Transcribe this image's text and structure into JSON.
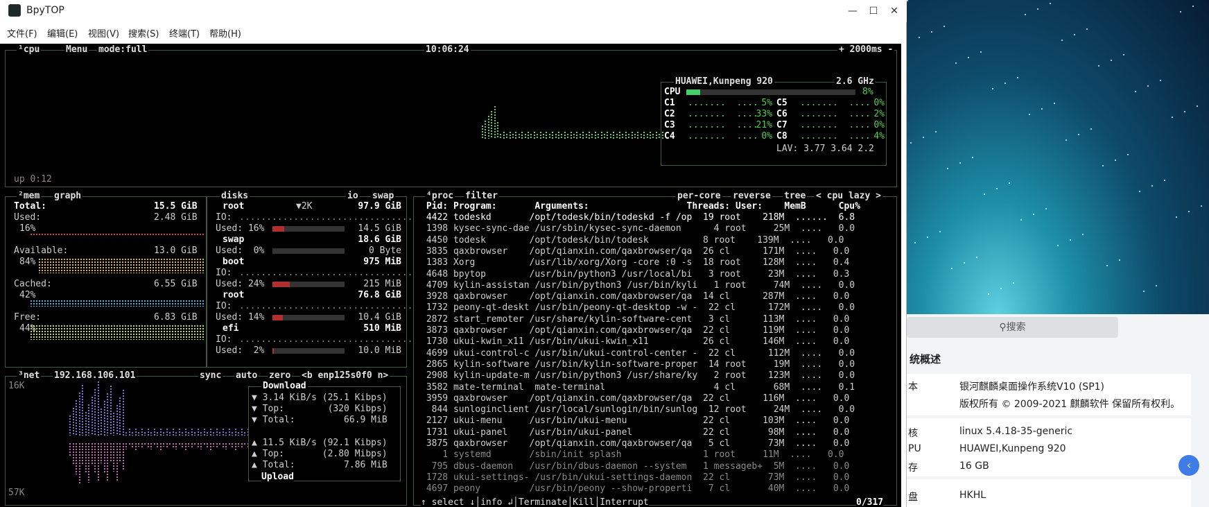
{
  "window": {
    "title": "BpyTOP",
    "minimize": "—",
    "maximize": "☐",
    "close": "✕"
  },
  "menu": [
    "文件(F)",
    "编辑(E)",
    "视图(V)",
    "搜索(S)",
    "终端(T)",
    "帮助(H)"
  ],
  "cpu": {
    "tab": "¹cpu",
    "menu": "Menu",
    "mode": "mode:full",
    "clock": "10:06:24",
    "interval": "2000ms",
    "uptime": "up 0:12",
    "model": "HUAWEI,Kunpeng 920",
    "freq": "2.6 GHz",
    "total_label": "CPU",
    "total_pct": "8%",
    "total_frac": 0.08,
    "cores": [
      {
        "n": "C1",
        "p": "5%"
      },
      {
        "n": "C5",
        "p": "0%"
      },
      {
        "n": "C2",
        "p": "33%"
      },
      {
        "n": "C6",
        "p": "2%"
      },
      {
        "n": "C3",
        "p": "21%"
      },
      {
        "n": "C7",
        "p": "0%"
      },
      {
        "n": "C4",
        "p": "0%"
      },
      {
        "n": "C8",
        "p": "4%"
      }
    ],
    "lav": "LAV: 3.77 3.64 2.2"
  },
  "mem": {
    "tab": "²mem",
    "graph": "graph",
    "total_label": "Total:",
    "total": "15.5 GiB",
    "used_label": "Used:",
    "used": "2.48 GiB",
    "used_pct": "16%",
    "avail_label": "Available:",
    "avail": "13.0 GiB",
    "avail_pct": "84%",
    "cached_label": "Cached:",
    "cached": "6.55 GiB",
    "cached_pct": "42%",
    "free_label": "Free:",
    "free": "6.83 GiB",
    "free_pct": "44%"
  },
  "disks": {
    "tab": "disks",
    "io": "io",
    "swap": "swap",
    "items": [
      {
        "name": "root",
        "extra": "▼2K",
        "size": "97.9 GiB",
        "io": "IO:",
        "used": "Used: 16%",
        "val": "14.5 GiB",
        "frac": 0.16
      },
      {
        "name": "swap",
        "extra": "",
        "size": "18.6 GiB",
        "io": "",
        "used": "Used:  0%",
        "val": "0 Byte",
        "frac": 0
      },
      {
        "name": "boot",
        "extra": "",
        "size": "975 MiB",
        "io": "IO:",
        "used": "Used: 24%",
        "val": "215 MiB",
        "frac": 0.24
      },
      {
        "name": "root",
        "extra": "",
        "size": "76.8 GiB",
        "io": "IO:",
        "used": "Used: 14%",
        "val": "10.4 GiB",
        "frac": 0.14
      },
      {
        "name": "efi",
        "extra": "",
        "size": "510 MiB",
        "io": "IO:",
        "used": "Used:  2%",
        "val": "10.0 MiB",
        "frac": 0.02
      }
    ]
  },
  "net": {
    "tab": "³net",
    "ip": "192.168.106.101",
    "sync": "sync",
    "auto": "auto",
    "zero": "zero",
    "iface": "<b enp125s0f0 n>",
    "scale_top": "16K",
    "scale_bot": "57K",
    "download": "Download",
    "dl_rate": "▼ 3.14 KiB/s (25.1 Kibps)",
    "dl_top": "▼ Top:        (320 Kibps)",
    "dl_total": "▼ Total:         66.9 MiB",
    "ul_rate": "▲ 11.5 KiB/s (92.1 Kibps)",
    "ul_top": "▲ Top:       (2.80 Mibps)",
    "ul_total": "▲ Total:         7.86 MiB",
    "upload": "Upload"
  },
  "proc": {
    "tab": "⁴proc",
    "filter": "filter",
    "per_core": "per-core",
    "reverse": "reverse",
    "tree": "tree",
    "sort": "< cpu lazy >",
    "header": " Pid: Program:       Arguments:                  Threads: User:    MemB      Cpu%",
    "rows": [
      " 4422 todeskd       /opt/todesk/bin/todeskd -f /op  19 root    218M  ......  6.8",
      " 1398 kysec-sync-dae /usr/sbin/kysec-sync-daemon      4 root     25M  ....   0.0",
      " 4450 todesk        /opt/todesk/bin/todesk          8 root    139M  ....   0.0",
      " 3835 qaxbrowser    /opt/qianxin.com/qaxbrowser/qa  26 cl      171M  ....   0.0",
      " 1383 Xorg          /usr/lib/xorg/Xorg -core :0 -s  18 root    128M  ....   0.4",
      " 4648 bpytop        /usr/bin/python3 /usr/local/bi   3 root     23M  ....   0.3",
      " 4709 kylin-assistan /usr/bin/python3 /usr/bin/kyli   1 root     74M  ....   0.0",
      " 3928 qaxbrowser    /opt/qianxin.com/qaxbrowser/qa  14 cl      287M  ....   0.0",
      " 1732 peony-qt-deskt /usr/bin/peony-qt-desktop -w -  22 cl      172M  ....   0.0",
      " 2872 start_remoter /usr/share/kylin-software-cent   3 cl      113M  ....   0.0",
      " 3873 qaxbrowser    /opt/qianxin.com/qaxbrowser/qa  22 cl      119M  ....   0.0",
      " 1730 ukui-kwin_x11 /usr/bin/ukui-kwin_x11          26 cl      146M  ....   0.0",
      " 4699 ukui-control-c /usr/bin/ukui-control-center -  22 cl      112M  ....   0.0",
      " 2865 kylin-software /usr/bin/kylin-software-proper  14 root     19M  ....   0.0",
      " 2908 kylin-update-m /usr/bin/python3 /usr/share/ky   2 root    123M  ....   0.0",
      " 3582 mate-terminal  mate-terminal                    4 cl       68M  ....   0.1",
      " 3959 qaxbrowser    /opt/qianxin.com/qaxbrowser/qa  22 cl      116M  ....   0.0",
      "  844 sunloginclient /usr/local/sunlogin/bin/sunlog  12 root     24M  ....   0.0",
      " 2127 ukui-menu     /usr/bin/ukui-menu              22 cl      103M  ....   0.0",
      " 1731 ukui-panel    /usr/bin/ukui-panel             22 cl       98M  ....   0.0",
      " 3875 qaxbrowser    /opt/qianxin.com/qaxbrowser/qa   5 cl       73M  ....   0.0",
      "    1 systemd       /sbin/init splash               1 root     11M  ....   0.0",
      "  795 dbus-daemon   /usr/bin/dbus-daemon --system   1 messageb+  5M  ....   0.0",
      " 1728 ukui-settings- /usr/bin/ukui-settings-daemon  22 cl       73M  ....   0.0",
      " 4697 peony         /usr/bin/peony --show-properti   7 cl       40M  ....   0.0"
    ],
    "footer": "↑ select ↓│info ↲│Terminate│Kill│Interrupt",
    "count": "0/317"
  },
  "sysinfo": {
    "search": "搜索",
    "title": "统概述",
    "rows": [
      {
        "label": "本",
        "value": "银河麒麟桌面操作系统V10 (SP1)"
      },
      {
        "label": "",
        "value": "版权所有 © 2009-2021 麒麟软件 保留所有权利。"
      },
      {
        "label": "核",
        "value": "linux 5.4.18-35-generic"
      },
      {
        "label": "PU",
        "value": "HUAWEI,Kunpeng 920"
      },
      {
        "label": "存",
        "value": "16 GB"
      },
      {
        "label": "盘",
        "value": "HKHL"
      }
    ],
    "edge_btn": "‹"
  }
}
